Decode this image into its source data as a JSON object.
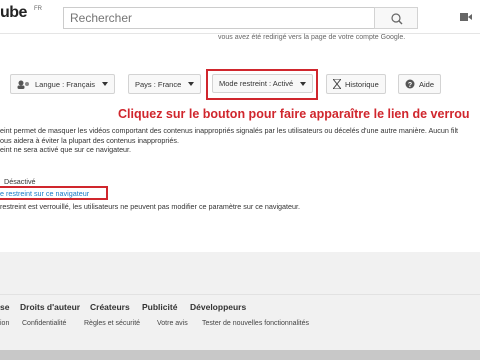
{
  "masthead": {
    "logo_text": "ube",
    "country_code": "FR",
    "search_placeholder": "Rechercher"
  },
  "panel": {
    "top_note": "vous avez été redirigé vers la page de votre compte Google."
  },
  "toolbar": {
    "language_label": "Langue : Français",
    "country_label": "Pays : France",
    "restricted_label": "Mode restreint : Activé",
    "history_label": "Historique",
    "help_label": "Aide"
  },
  "instruction": "Cliquez sur le bouton pour faire apparaître le lien de verrou",
  "description": {
    "line1": "eint permet de masquer les vidéos comportant des contenus inappropriés signalés par les utilisateurs ou décelés d'une autre manière. Aucun filt",
    "line2": "ous aidera à éviter la plupart des contenus inappropriés.",
    "line3": "eint ne sera activé que sur ce navigateur."
  },
  "status_option": "Désactivé",
  "lock_link": "e restreint sur ce navigateur",
  "lock_note": "restreint est verrouillé, les utilisateurs ne peuvent pas modifier ce paramètre sur ce navigateur.",
  "footer": {
    "primary": [
      "se",
      "Droits d'auteur",
      "Créateurs",
      "Publicité",
      "Développeurs"
    ],
    "secondary": [
      "ion",
      "Confidentialité",
      "Règles et sécurité",
      "Votre avis",
      "Tester de nouvelles fonctionnalités"
    ]
  },
  "colors": {
    "accent_red": "#d0262d",
    "link_blue": "#167ac6"
  }
}
